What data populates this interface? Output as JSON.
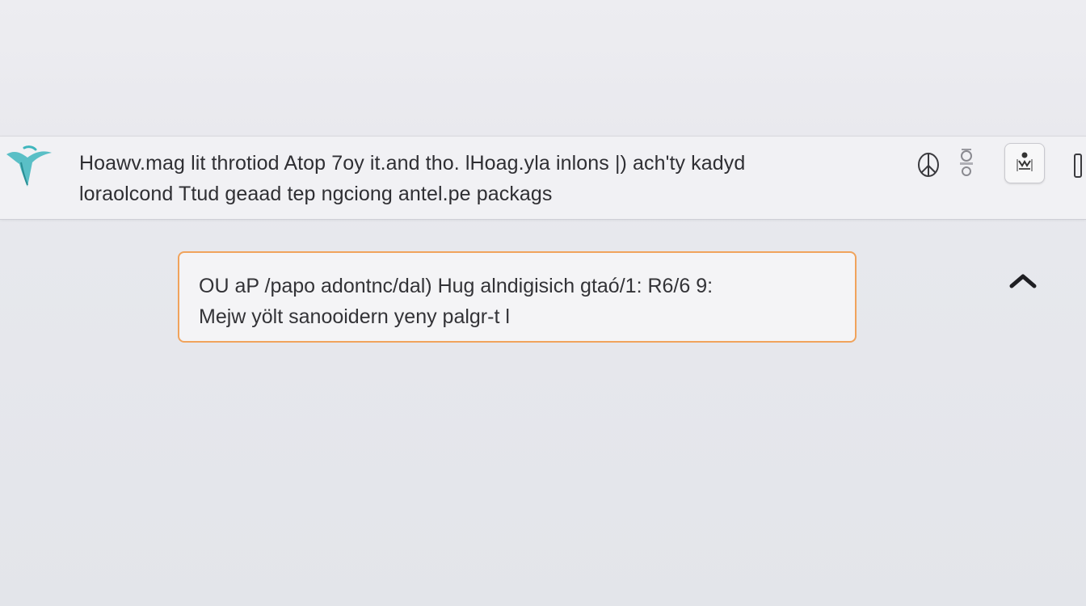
{
  "header": {
    "line1": "Hoawv.mag lit throtiod Atop 7oy it.and tho. lHoag.yla inlons |)  ach'ty kadyd",
    "line2": "loraolcond Ttud geaad tep ngciong antel.pe packags",
    "icons": {
      "logo": "teal-brush-logo-icon",
      "peace": "peace-sign-icon",
      "toggle": "toggle-switch-icon",
      "tile": "app-tile-icon",
      "tile_label": "ꝗ",
      "handle": "edge-handle-icon"
    }
  },
  "notice": {
    "line1": "OU aP /papo adontnc/dal) Hug alndigisich gtaó/1: R6/6 9:",
    "line2": "Mejw yölt sanooidern yeny palgr-t l",
    "border_color": "#f0a35c"
  },
  "collapse": {
    "icon": "chevron-up-icon"
  },
  "colors": {
    "accent": "#f0a35c",
    "logo": "#3fb6bd"
  }
}
